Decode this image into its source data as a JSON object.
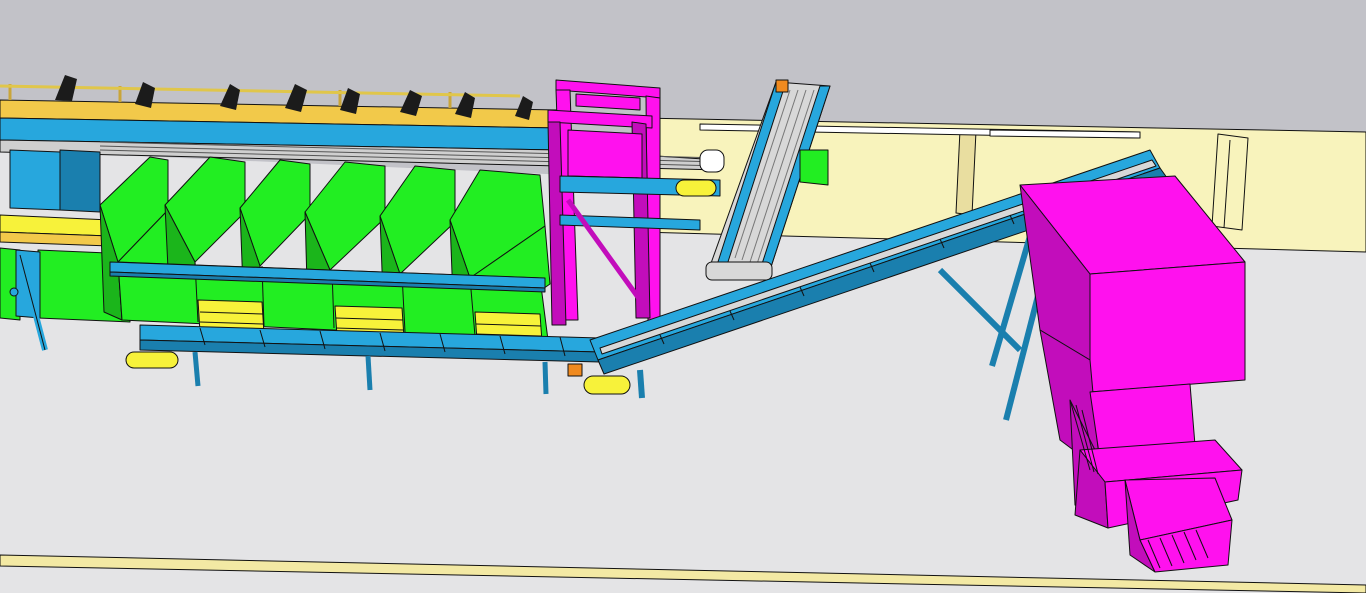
{
  "scene": {
    "description_label": "",
    "colors": {
      "sky": "#c2c2c8",
      "floor": "#e4e4e6",
      "wall": "#f8f3bc",
      "wall_shadow": "#e9dea0",
      "conveyor": "#27a7dd",
      "conveyor_dark": "#1a7fae",
      "bin": "#22ee22",
      "bin_dark": "#1bb51b",
      "magenta": "#ff11ee",
      "magenta_dark": "#c20dbb",
      "yellow": "#f7f23a",
      "yellow_dark": "#c9c51e",
      "rail": "#e0c64a",
      "outline": "#111111",
      "roller": "#d8d8d8",
      "orange": "#f08a1f",
      "shadow": "#8e8e96"
    },
    "icons": [
      "sorting-line-model"
    ]
  }
}
